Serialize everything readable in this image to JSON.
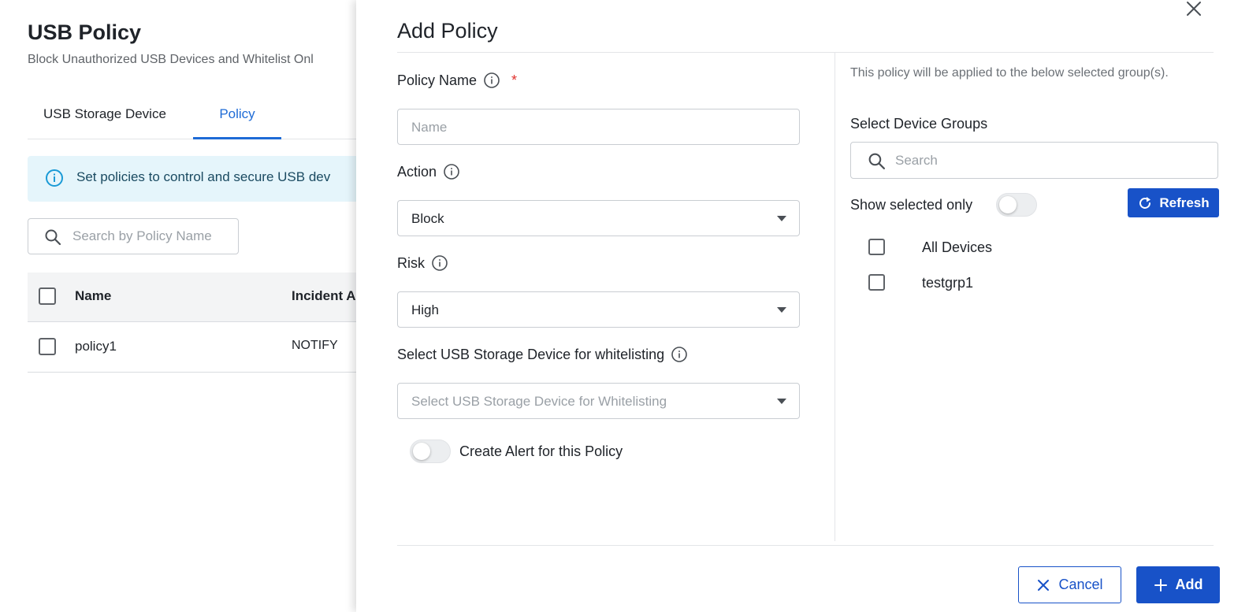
{
  "background": {
    "title": "USB Policy",
    "subtitle": "Block Unauthorized USB Devices and Whitelist Onl",
    "tabs": [
      {
        "label": "USB Storage Device",
        "active": false
      },
      {
        "label": "Policy",
        "active": true
      }
    ],
    "info_banner": "Set policies to control and secure USB dev",
    "search_placeholder": "Search by Policy Name",
    "table": {
      "columns": [
        "Name",
        "Incident A"
      ],
      "rows": [
        {
          "name": "policy1",
          "incident_action": "NOTIFY"
        }
      ]
    }
  },
  "drawer": {
    "title": "Add Policy",
    "policy_name": {
      "label": "Policy Name",
      "required_mark": "*",
      "value": "",
      "placeholder": "Name"
    },
    "action": {
      "label": "Action",
      "value": "Block"
    },
    "risk": {
      "label": "Risk",
      "value": "High"
    },
    "whitelist": {
      "label": "Select USB Storage Device for whitelisting",
      "placeholder": "Select USB Storage Device for Whitelisting"
    },
    "create_alert": {
      "label": "Create Alert for this Policy",
      "enabled": false
    },
    "groups": {
      "note": "This policy will be applied to the below selected group(s).",
      "label": "Select Device Groups",
      "search_placeholder": "Search",
      "show_selected_label": "Show selected only",
      "show_selected_enabled": false,
      "refresh_label": "Refresh",
      "items": [
        {
          "label": "All Devices",
          "checked": false
        },
        {
          "label": "testgrp1",
          "checked": false
        }
      ]
    },
    "cancel_label": "Cancel",
    "add_label": "Add"
  },
  "colors": {
    "accent": "#1852c8",
    "tab_active": "#1e6bd6",
    "banner_bg": "#e5f5fb",
    "required": "#e0322d"
  }
}
